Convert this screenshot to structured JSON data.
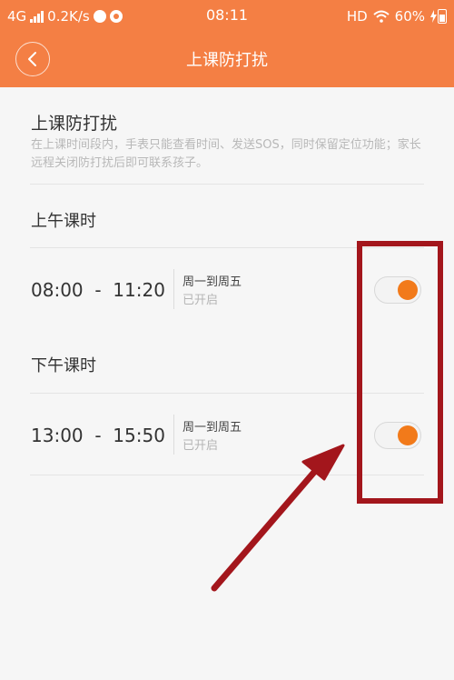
{
  "status_bar": {
    "network": "4G",
    "speed": "0.2K/s",
    "time": "08:11",
    "hd": "HD",
    "battery": "60%"
  },
  "nav": {
    "title": "上课防打扰"
  },
  "intro": {
    "title": "上课防打扰",
    "description": "在上课时间段内，手表只能查看时间、发送SOS，同时保留定位功能；家长远程关闭防打扰后即可联系孩子。"
  },
  "sections": [
    {
      "title": "上午课时",
      "range": "08:00  -  11:20",
      "days": "周一到周五",
      "status": "已开启",
      "enabled": true
    },
    {
      "title": "下午课时",
      "range": "13:00  -  15:50",
      "days": "周一到周五",
      "status": "已开启",
      "enabled": true
    }
  ],
  "colors": {
    "header": "#f47f44",
    "toggle_knob": "#f27a1a",
    "annotation": "#a3161c"
  }
}
